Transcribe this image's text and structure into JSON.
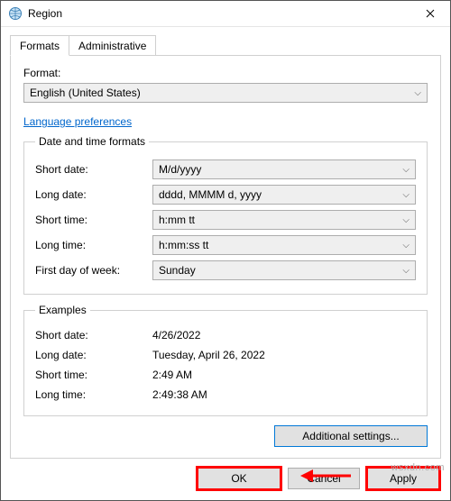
{
  "window": {
    "title": "Region"
  },
  "tabs": {
    "t0": "Formats",
    "t1": "Administrative"
  },
  "format": {
    "label": "Format:",
    "value": "English (United States)"
  },
  "link": "Language preferences",
  "group1": {
    "legend": "Date and time formats",
    "shortdate_lbl": "Short date:",
    "shortdate_val": "M/d/yyyy",
    "longdate_lbl": "Long date:",
    "longdate_val": "dddd, MMMM d, yyyy",
    "shorttime_lbl": "Short time:",
    "shorttime_val": "h:mm tt",
    "longtime_lbl": "Long time:",
    "longtime_val": "h:mm:ss tt",
    "firstday_lbl": "First day of week:",
    "firstday_val": "Sunday"
  },
  "group2": {
    "legend": "Examples",
    "shortdate_lbl": "Short date:",
    "shortdate_val": "4/26/2022",
    "longdate_lbl": "Long date:",
    "longdate_val": "Tuesday, April 26, 2022",
    "shorttime_lbl": "Short time:",
    "shorttime_val": "2:49 AM",
    "longtime_lbl": "Long time:",
    "longtime_val": "2:49:38 AM"
  },
  "buttons": {
    "additional": "Additional settings...",
    "ok": "OK",
    "cancel": "Cancel",
    "apply": "Apply"
  },
  "watermark": "wsxdn.com"
}
